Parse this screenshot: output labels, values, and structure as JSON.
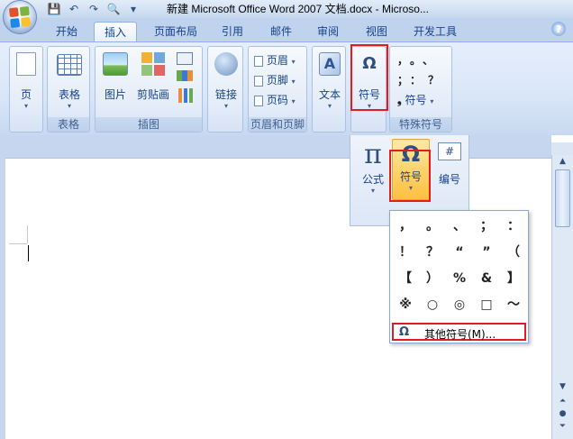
{
  "window": {
    "title": "新建 Microsoft Office Word 2007 文档.docx - Microso..."
  },
  "qat": {
    "save_icon": "💾",
    "undo_icon": "↶",
    "redo_icon": "↷",
    "preview_icon": "🔍",
    "more_icon": "▾"
  },
  "tabs": [
    {
      "label": "开始"
    },
    {
      "label": "插入"
    },
    {
      "label": "页面布局"
    },
    {
      "label": "引用"
    },
    {
      "label": "邮件"
    },
    {
      "label": "审阅"
    },
    {
      "label": "视图"
    },
    {
      "label": "开发工具"
    }
  ],
  "help_icon": "?",
  "groups": {
    "pages": {
      "button": "页",
      "label": ""
    },
    "tables": {
      "button": "表格",
      "label": "表格"
    },
    "illustrations": {
      "picture": "图片",
      "clipart": "剪贴画",
      "label": "插图"
    },
    "links": {
      "button": "链接",
      "label": ""
    },
    "header_footer": {
      "header": "页眉",
      "footer": "页脚",
      "page_number": "页码",
      "label": "页眉和页脚"
    },
    "text": {
      "button": "文本",
      "label": ""
    },
    "symbols": {
      "button": "符号",
      "label": ""
    },
    "special": {
      "row1": "，。、",
      "row2": "；：？",
      "symbol_btn": "符号",
      "label": "特殊符号"
    }
  },
  "glyphs": {
    "omega": "Ω",
    "pi": "π",
    "hash": "#",
    "arrow": "▾",
    "comma_bullet": "❟"
  },
  "submenu": {
    "formula": "公式",
    "symbol": "符号",
    "numbering": "编号"
  },
  "gallery": {
    "cells": [
      "，",
      "。",
      "、",
      "；",
      "：",
      "！",
      "？",
      "“",
      "”",
      "（",
      "【",
      "）",
      "%",
      "&",
      "】",
      "※",
      "○",
      "◎",
      "□",
      "～"
    ],
    "more": "其他符号(M)..."
  },
  "scrollbar": {
    "up": "▲",
    "down": "▼",
    "prev": "⏶",
    "select": "●",
    "next": "⏷"
  }
}
